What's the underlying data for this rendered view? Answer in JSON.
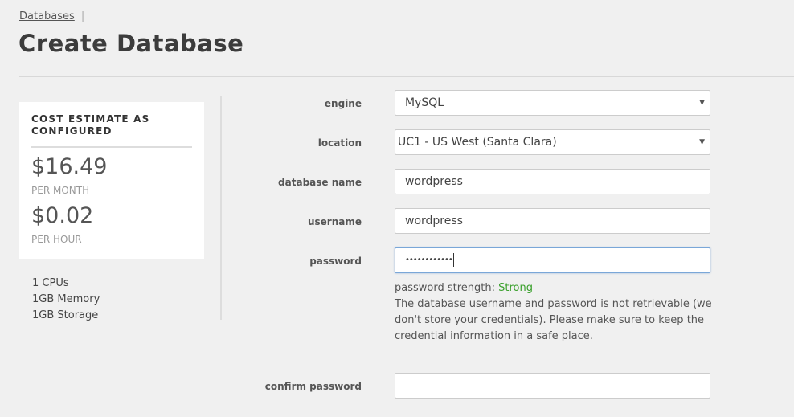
{
  "breadcrumb": {
    "databases_link": "Databases",
    "separator": "|"
  },
  "page_title": "Create Database",
  "cost_estimate": {
    "title": "COST ESTIMATE AS CONFIGURED",
    "monthly_price": "$16.49",
    "monthly_unit": "PER MONTH",
    "hourly_price": "$0.02",
    "hourly_unit": "PER HOUR"
  },
  "specs": {
    "cpus": "1 CPUs",
    "memory": "1GB Memory",
    "storage": "1GB Storage"
  },
  "form": {
    "engine": {
      "label": "engine",
      "value": "MySQL"
    },
    "location": {
      "label": "location",
      "value": "UC1 - US West (Santa Clara)"
    },
    "database_name": {
      "label": "database name",
      "value": "wordpress"
    },
    "username": {
      "label": "username",
      "value": "wordpress"
    },
    "password": {
      "label": "password",
      "value": "••••••••••••"
    },
    "password_strength_label": "password strength:",
    "password_strength_value": "Strong",
    "notice": [
      "The database username and password is not retrievable (we",
      "don't store your credentials). Please make sure to keep the",
      "credential information in a safe place."
    ],
    "confirm_password": {
      "label": "confirm password",
      "value": ""
    }
  },
  "colors": {
    "strength_strong": "#3aa02c",
    "focus_border": "#7aa7d8"
  },
  "icons": {
    "select_caret": "caret-down-icon"
  }
}
